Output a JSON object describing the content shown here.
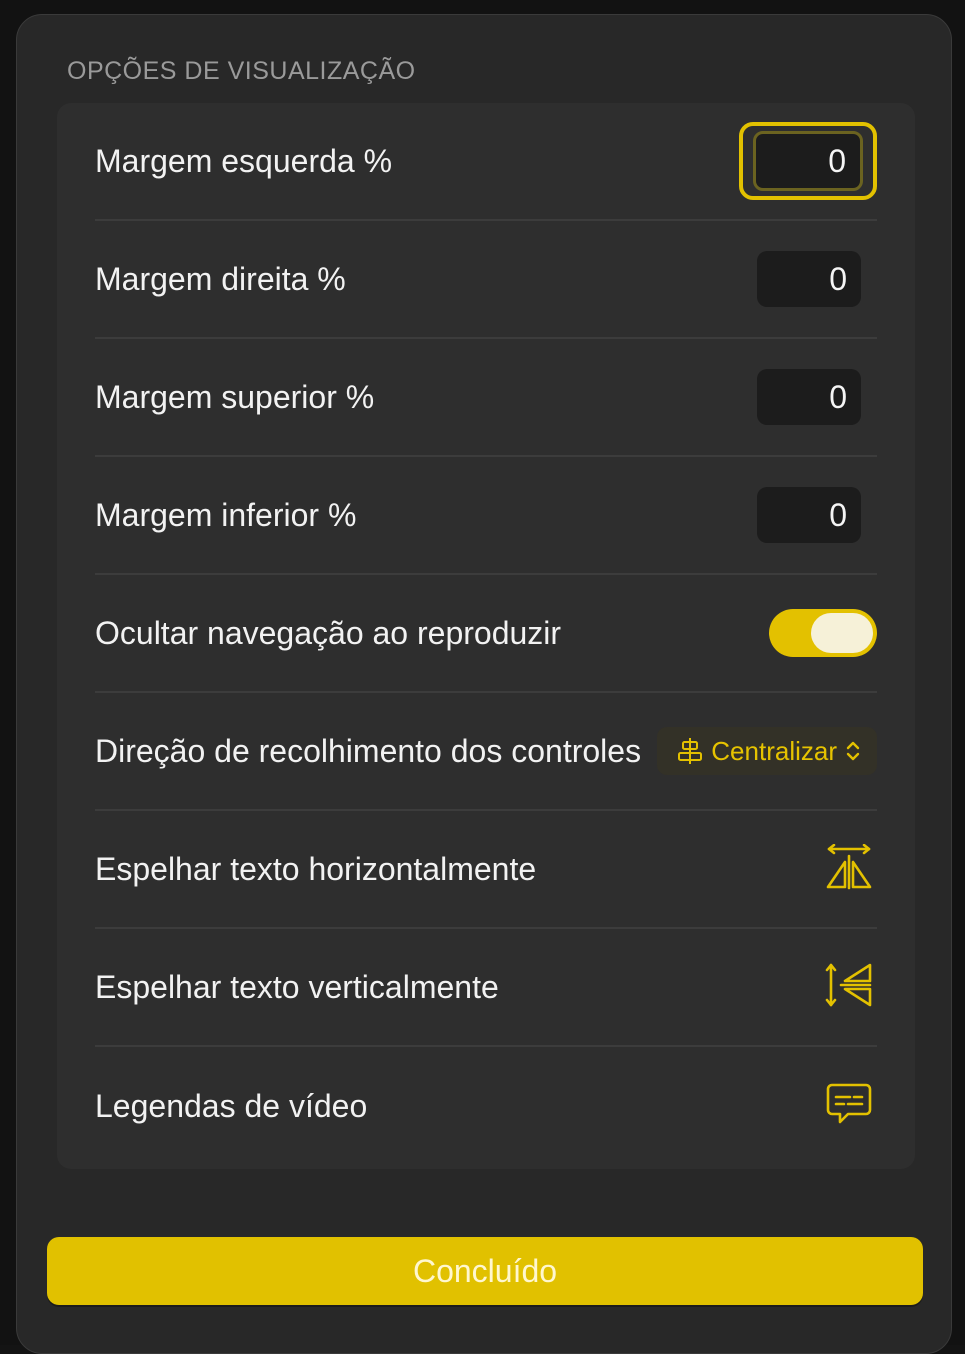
{
  "panel": {
    "section_title": "OPÇÕES DE VISUALIZAÇÃO",
    "done_label": "Concluído"
  },
  "rows": {
    "margin_left": {
      "label": "Margem esquerda %",
      "value": "0"
    },
    "margin_right": {
      "label": "Margem direita %",
      "value": "0"
    },
    "margin_top": {
      "label": "Margem superior %",
      "value": "0"
    },
    "margin_bottom": {
      "label": "Margem inferior %",
      "value": "0"
    },
    "hide_nav": {
      "label": "Ocultar navegação ao reproduzir",
      "on": true
    },
    "collapse_direction": {
      "label": "Direção de recolhimento dos controles",
      "value": "Centralizar"
    },
    "mirror_horizontal": {
      "label": "Espelhar texto horizontalmente",
      "icon": "mirror-horizontal-icon"
    },
    "mirror_vertical": {
      "label": "Espelhar texto verticalmente",
      "icon": "mirror-vertical-icon"
    },
    "captions": {
      "label": "Legendas de vídeo",
      "icon": "captions-icon"
    }
  },
  "colors": {
    "accent": "#e3c100",
    "sheet_bg": "#282828",
    "group_bg": "#2e2e2e",
    "field_bg": "#1c1c1c"
  }
}
